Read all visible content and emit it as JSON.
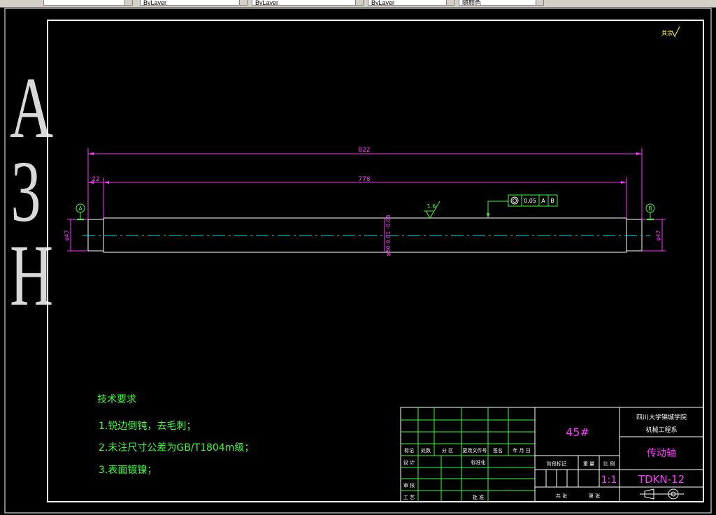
{
  "toolbar": {
    "fields": [
      "",
      "ByLayer",
      "ByLayer",
      "ByLayer",
      "随颜色"
    ]
  },
  "sheet": {
    "side_label": [
      "A",
      "3",
      "H"
    ],
    "corner_roughness": "其余"
  },
  "drawing": {
    "dims": {
      "overall": "822",
      "inner": "778",
      "left_offset": "22",
      "diameter_left": "φ47",
      "diameter_right": "φ47",
      "diameter_center": "φ50-0.01\n-0.03",
      "roughness": "1.6"
    },
    "datums": {
      "a": "A",
      "b": "B"
    },
    "tolerance_frame": [
      "◎",
      "0.05",
      "A",
      "B"
    ]
  },
  "tech_requirements": {
    "title": "技术要求",
    "items": [
      "1.锐边倒钝，去毛刺；",
      "2.未注尺寸公差为GB/T1804m级；",
      "3.表面镀镍；"
    ]
  },
  "title_block": {
    "material": "45#",
    "school": "四川大学锦城学院",
    "department": "机械工程系",
    "part_name": "传动轴",
    "drawing_no": "TDKN-12",
    "scale": "1:1",
    "labels": {
      "mark": "标记",
      "count": "处数",
      "zone": "分 区",
      "change_doc": "更改文件号",
      "sign": "签名",
      "date": "年 月 日",
      "design": "设 计",
      "standardize": "标准化",
      "stage_mark": "阶段标记",
      "weight": "重 量",
      "ratio": "比 例",
      "review": "审 核",
      "process": "工 艺",
      "approve": "批 准",
      "total": "共   张",
      "sheet": "第   张"
    }
  },
  "colors": {
    "green": "#33ff33",
    "magenta": "#ff33ff",
    "cyan": "#00e5e5",
    "white": "#ffffff",
    "yellow": "#ffff33",
    "background": "#000000"
  }
}
